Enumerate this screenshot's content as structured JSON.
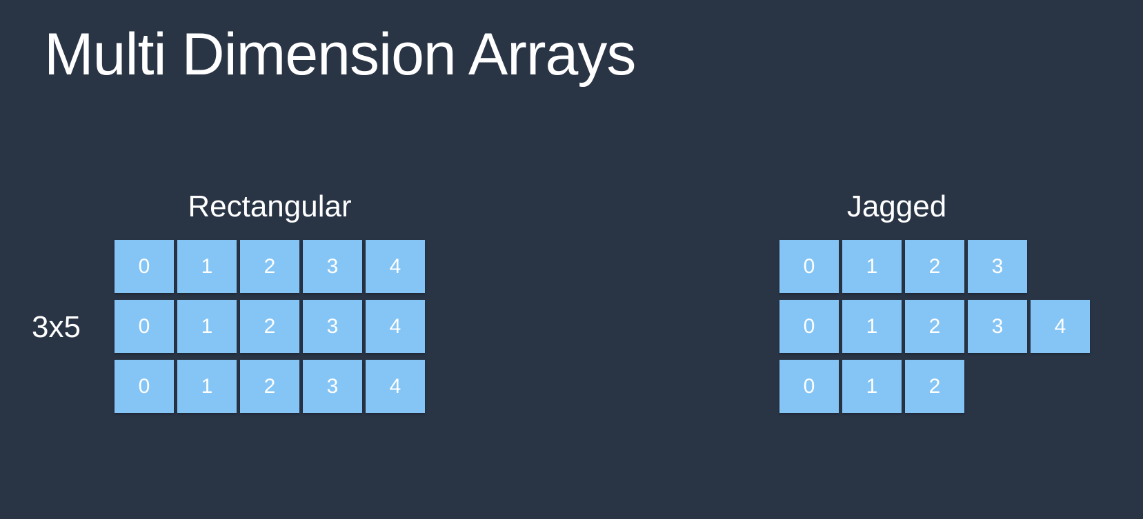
{
  "title": "Multi Dimension Arrays",
  "colors": {
    "background": "#293445",
    "cell": "#85c5f5",
    "text": "#ffffff"
  },
  "rectangular": {
    "label": "Rectangular",
    "dims_label": "3x5",
    "rows": [
      [
        "0",
        "1",
        "2",
        "3",
        "4"
      ],
      [
        "0",
        "1",
        "2",
        "3",
        "4"
      ],
      [
        "0",
        "1",
        "2",
        "3",
        "4"
      ]
    ]
  },
  "jagged": {
    "label": "Jagged",
    "rows": [
      [
        "0",
        "1",
        "2",
        "3"
      ],
      [
        "0",
        "1",
        "2",
        "3",
        "4"
      ],
      [
        "0",
        "1",
        "2"
      ]
    ]
  }
}
